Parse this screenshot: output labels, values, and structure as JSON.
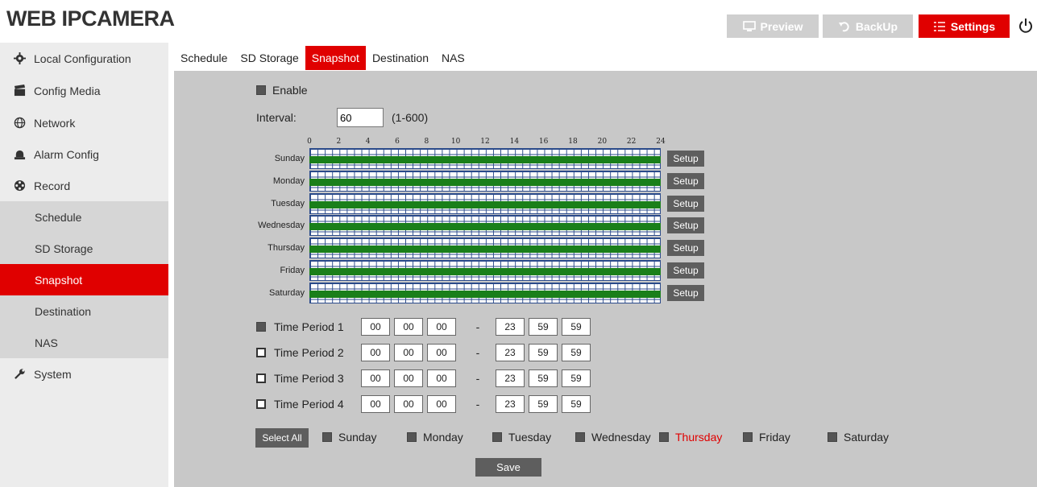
{
  "header": {
    "brand": "WEB IPCAMERA",
    "buttons": {
      "preview": "Preview",
      "backup": "BackUp",
      "settings": "Settings"
    },
    "accent_color": "#e00000"
  },
  "sidebar": {
    "items": [
      {
        "label": "Local Configuration",
        "icon": "gear-icon"
      },
      {
        "label": "Config Media",
        "icon": "clapperboard-icon"
      },
      {
        "label": "Network",
        "icon": "globe-icon"
      },
      {
        "label": "Alarm Config",
        "icon": "alarm-bell-icon"
      },
      {
        "label": "Record",
        "icon": "film-reel-icon"
      }
    ],
    "subitems": [
      "Schedule",
      "SD Storage",
      "Snapshot",
      "Destination",
      "NAS"
    ],
    "active_subitem": "Snapshot",
    "system": {
      "label": "System",
      "icon": "wrench-icon"
    }
  },
  "tabs": [
    "Schedule",
    "SD Storage",
    "Snapshot",
    "Destination",
    "NAS"
  ],
  "active_tab": "Snapshot",
  "form": {
    "enable_label": "Enable",
    "interval_label": "Interval:",
    "interval_value": "60",
    "interval_range": "(1-600)"
  },
  "schedule": {
    "hour_labels": [
      "0",
      "2",
      "4",
      "6",
      "8",
      "10",
      "12",
      "14",
      "16",
      "18",
      "20",
      "22",
      "24"
    ],
    "days": [
      "Sunday",
      "Monday",
      "Tuesday",
      "Wednesday",
      "Thursday",
      "Friday",
      "Saturday"
    ],
    "setup_label": "Setup",
    "coverage_fraction": 1.0,
    "bar_color": "#1a7f1a"
  },
  "time_periods": [
    {
      "label": "Time Period 1",
      "checked": true,
      "start": [
        "00",
        "00",
        "00"
      ],
      "end": [
        "23",
        "59",
        "59"
      ],
      "sep": "-"
    },
    {
      "label": "Time Period 2",
      "checked": false,
      "start": [
        "00",
        "00",
        "00"
      ],
      "end": [
        "23",
        "59",
        "59"
      ],
      "sep": "-"
    },
    {
      "label": "Time Period 3",
      "checked": false,
      "start": [
        "00",
        "00",
        "00"
      ],
      "end": [
        "23",
        "59",
        "59"
      ],
      "sep": "-"
    },
    {
      "label": "Time Period 4",
      "checked": false,
      "start": [
        "00",
        "00",
        "00"
      ],
      "end": [
        "23",
        "59",
        "59"
      ],
      "sep": "-"
    }
  ],
  "day_select": {
    "select_all": "Select All",
    "days": [
      "Sunday",
      "Monday",
      "Tuesday",
      "Wednesday",
      "Thursday",
      "Friday",
      "Saturday"
    ],
    "highlighted": "Thursday"
  },
  "save_label": "Save"
}
